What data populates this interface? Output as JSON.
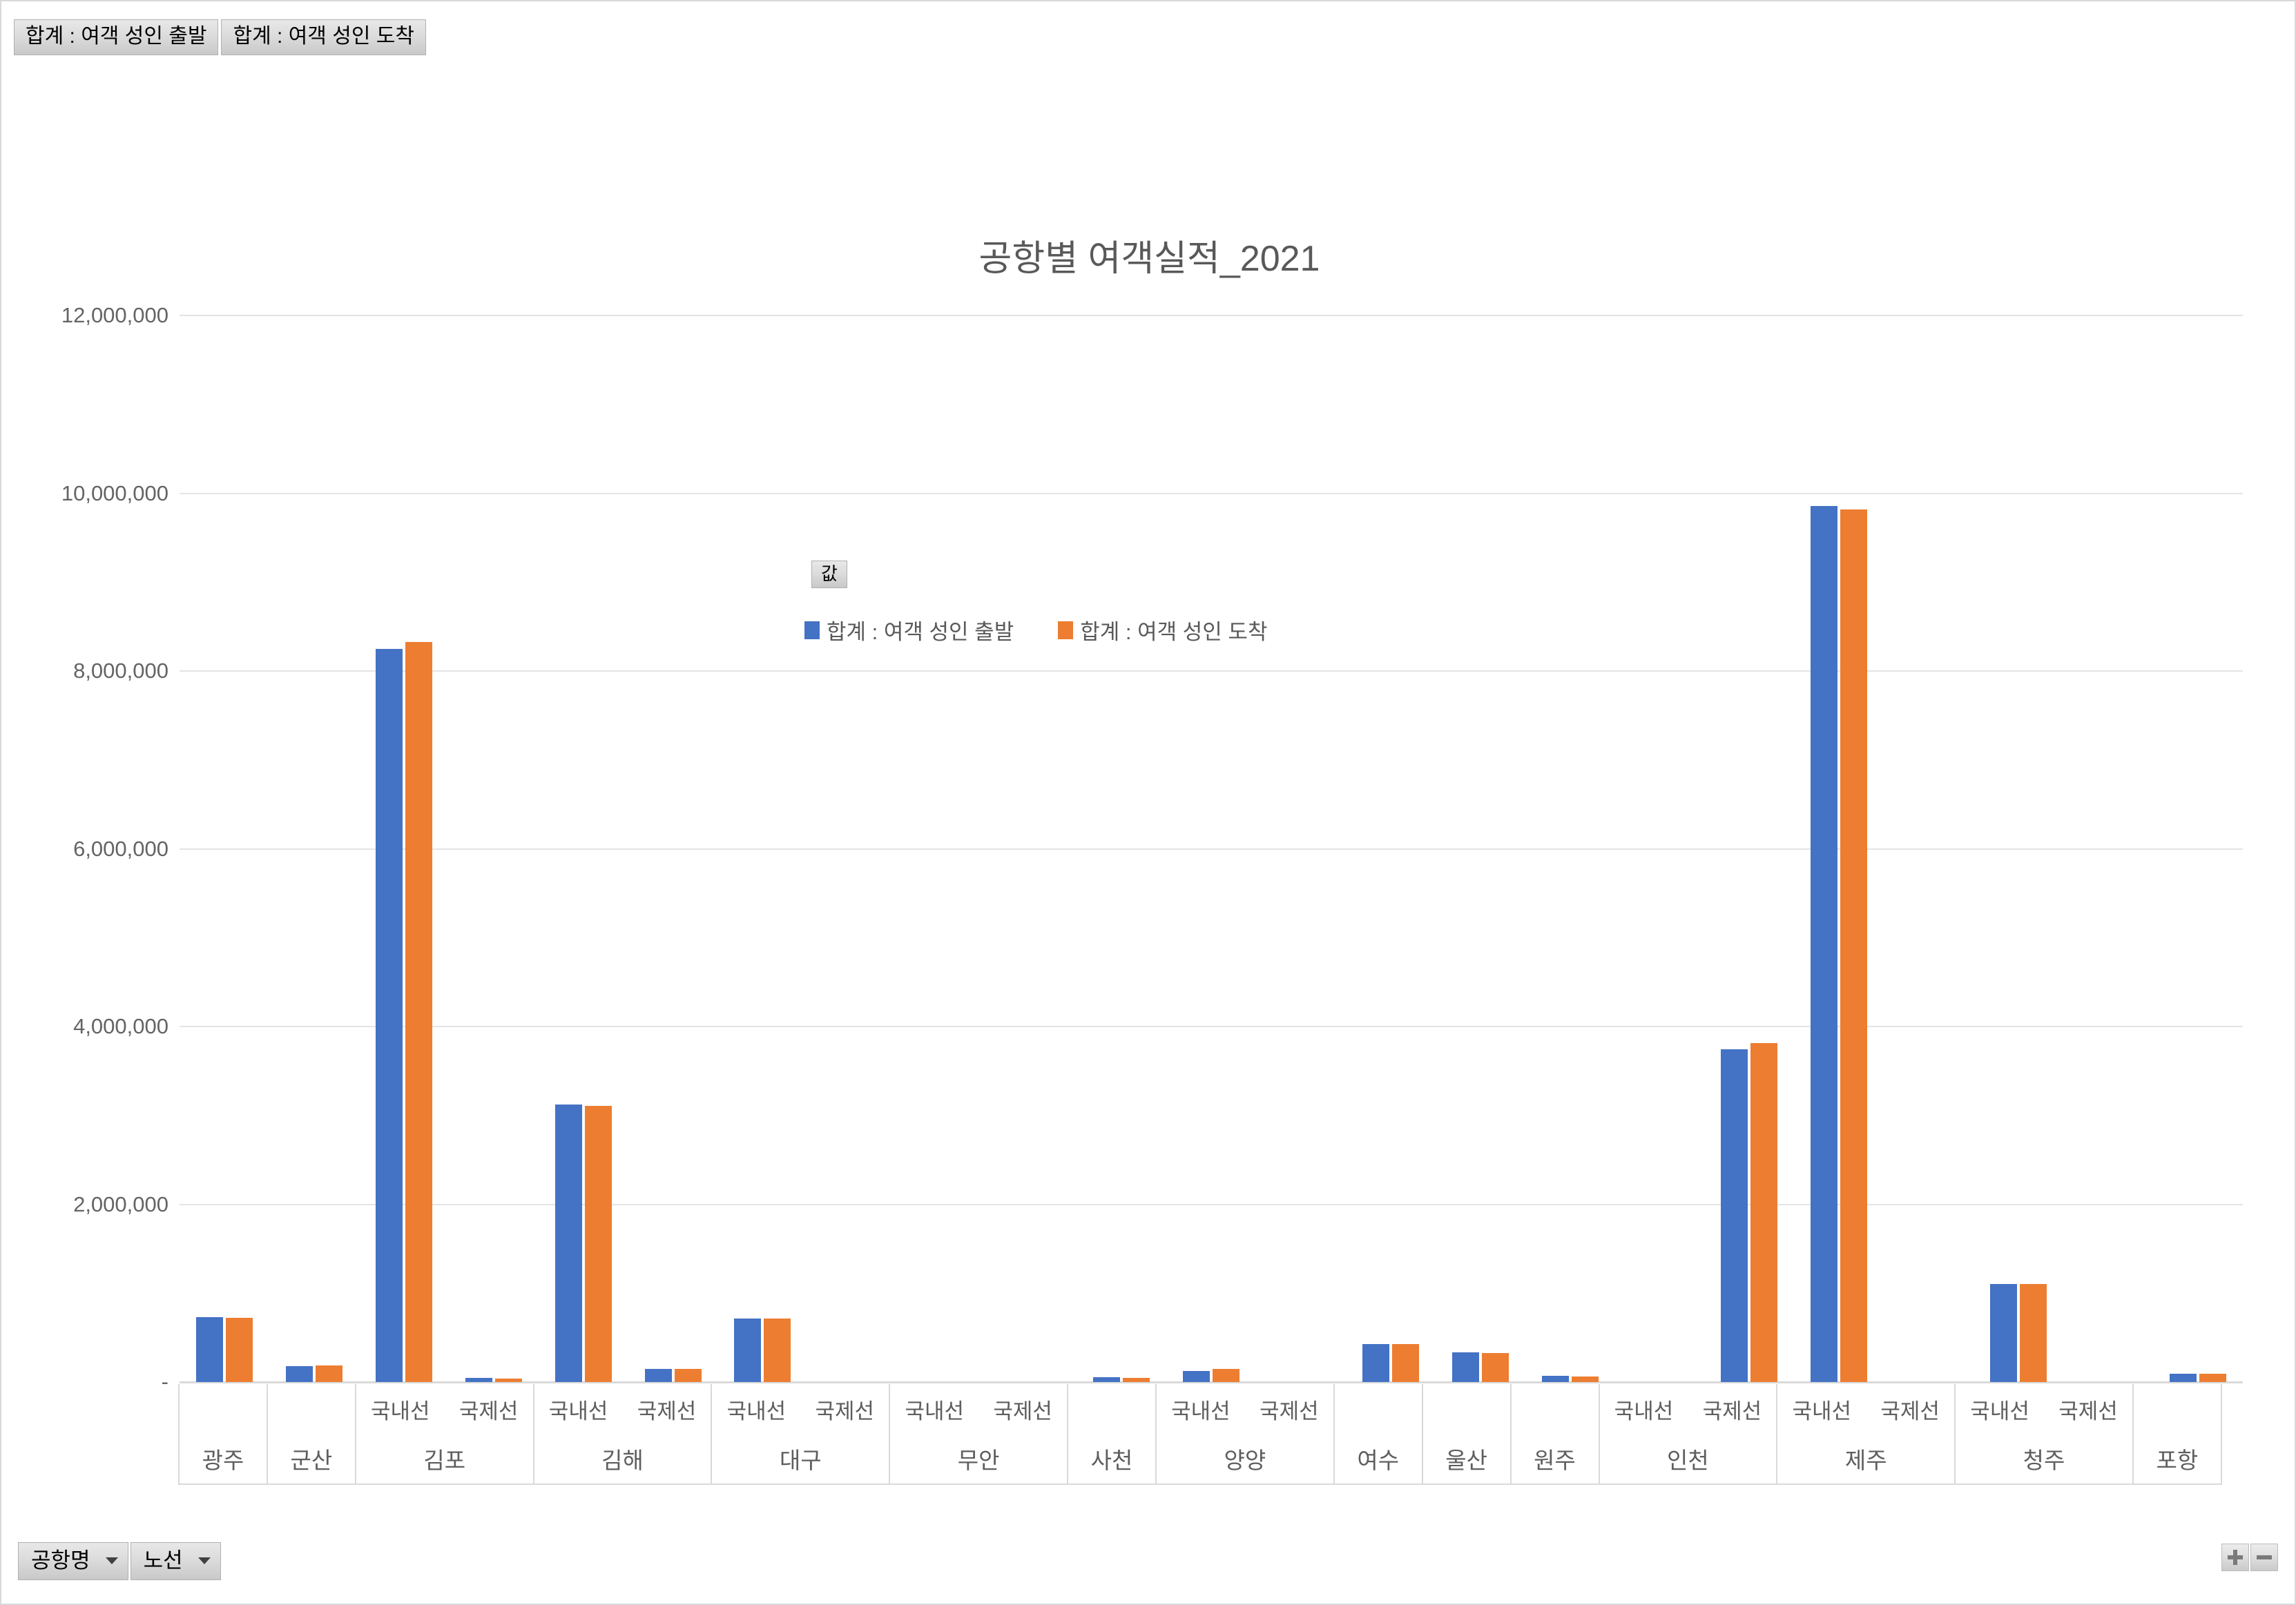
{
  "top_field_buttons": [
    {
      "label": "합계 : 여객 성인 출발"
    },
    {
      "label": "합계 : 여객 성인 도착"
    }
  ],
  "chart": {
    "title": "공항별 여객실적_2021",
    "legend_field_label": "값"
  },
  "bottom_field_buttons": [
    {
      "label": "공항명"
    },
    {
      "label": "노선"
    }
  ],
  "zoom_controls": {
    "expand_label": "+",
    "collapse_label": "−"
  },
  "colors": {
    "series1": "#4472C4",
    "series2": "#ED7D31",
    "gridline": "#E4E4E4",
    "axis": "#D9D9D9",
    "text": "#595959"
  },
  "chart_data": {
    "type": "bar",
    "title": "공항별 여객실적_2021",
    "xlabel": "",
    "ylabel": "",
    "ylim": [
      0,
      12000000
    ],
    "yticks": [
      0,
      2000000,
      4000000,
      6000000,
      8000000,
      10000000,
      12000000
    ],
    "ytick_labels": [
      "-",
      "2,000,000",
      "4,000,000",
      "6,000,000",
      "8,000,000",
      "10,000,000",
      "12,000,000"
    ],
    "grid": true,
    "legend_position": "top-center-inside",
    "series": [
      {
        "name": "합계 : 여객 성인 출발",
        "color": "#4472C4",
        "values": [
          730000,
          180000,
          8250000,
          45000,
          3120000,
          150000,
          715000,
          0,
          0,
          0,
          55000,
          125000,
          0,
          430000,
          335000,
          70000,
          0,
          3740000,
          9855000,
          0,
          1105000,
          0,
          95000
        ]
      },
      {
        "name": "합계 : 여객 성인 도착",
        "color": "#ED7D31",
        "values": [
          722000,
          185000,
          8330000,
          38000,
          3105000,
          145000,
          715000,
          0,
          0,
          0,
          48000,
          150000,
          0,
          425000,
          330000,
          62000,
          0,
          3815000,
          9820000,
          0,
          1100000,
          0,
          92000
        ]
      }
    ],
    "categories": [
      {
        "airport": "광주",
        "routes": [
          ""
        ]
      },
      {
        "airport": "군산",
        "routes": [
          ""
        ]
      },
      {
        "airport": "김포",
        "routes": [
          "국내선",
          "국제선"
        ]
      },
      {
        "airport": "김해",
        "routes": [
          "국내선",
          "국제선"
        ]
      },
      {
        "airport": "대구",
        "routes": [
          "국내선",
          "국제선"
        ]
      },
      {
        "airport": "무안",
        "routes": [
          "국내선",
          "국제선"
        ]
      },
      {
        "airport": "사천",
        "routes": [
          ""
        ]
      },
      {
        "airport": "양양",
        "routes": [
          "국내선",
          "국제선"
        ]
      },
      {
        "airport": "여수",
        "routes": [
          ""
        ]
      },
      {
        "airport": "울산",
        "routes": [
          ""
        ]
      },
      {
        "airport": "원주",
        "routes": [
          ""
        ]
      },
      {
        "airport": "인천",
        "routes": [
          "국내선",
          "국제선"
        ]
      },
      {
        "airport": "제주",
        "routes": [
          "국내선",
          "국제선"
        ]
      },
      {
        "airport": "청주",
        "routes": [
          "국내선",
          "국제선"
        ]
      },
      {
        "airport": "포항",
        "routes": [
          ""
        ]
      }
    ]
  }
}
